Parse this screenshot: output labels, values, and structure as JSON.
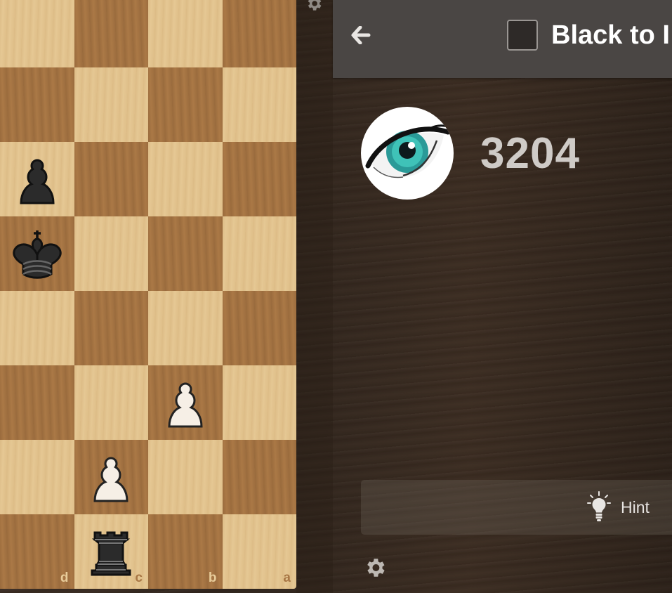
{
  "header": {
    "turn_text": "Black to I"
  },
  "profile": {
    "rating": "3204"
  },
  "controls": {
    "hint_label": "Hint"
  },
  "board": {
    "files": [
      "d",
      "c",
      "b",
      "a"
    ],
    "pieces": [
      {
        "square": "d6",
        "piece": "black-pawn"
      },
      {
        "square": "d5",
        "piece": "black-king"
      },
      {
        "square": "b3",
        "piece": "white-pawn"
      },
      {
        "square": "c2",
        "piece": "white-pawn"
      },
      {
        "square": "c1",
        "piece": "black-rook"
      }
    ]
  },
  "colors": {
    "light_square": "#e3c48f",
    "dark_square": "#a87745",
    "header_bg": "#4a4644"
  },
  "icons": {
    "back": "arrow-left-icon",
    "hint": "lightbulb-icon",
    "settings": "gear-icon"
  }
}
